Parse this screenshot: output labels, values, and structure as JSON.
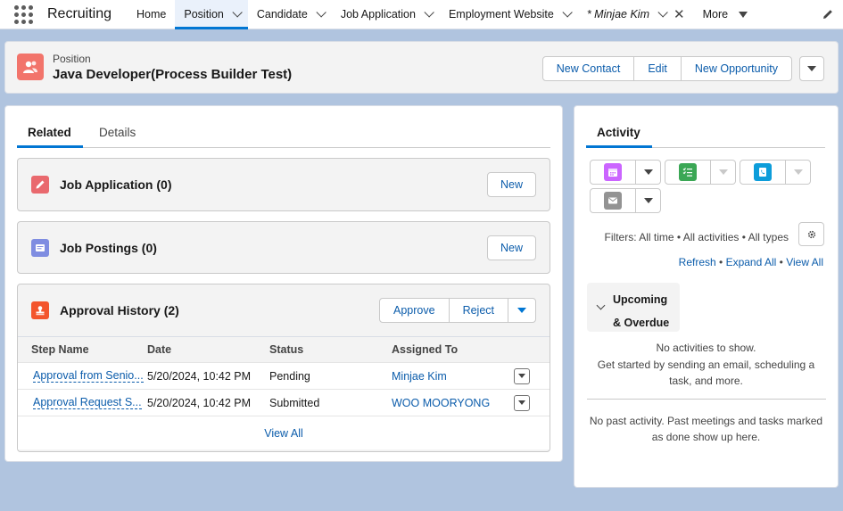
{
  "app": {
    "name": "Recruiting"
  },
  "nav": {
    "items": [
      {
        "label": "Home"
      },
      {
        "label": "Position"
      },
      {
        "label": "Candidate"
      },
      {
        "label": "Job Application"
      },
      {
        "label": "Employment Website"
      },
      {
        "label": "* Minjae Kim"
      },
      {
        "label": "More"
      }
    ]
  },
  "record": {
    "object_label": "Position",
    "title": "Java Developer(Process Builder Test)",
    "actions": {
      "new_contact": "New Contact",
      "edit": "Edit",
      "new_opportunity": "New Opportunity"
    }
  },
  "tabs": {
    "related": "Related",
    "details": "Details"
  },
  "related": {
    "job_application": {
      "title": "Job Application (0)",
      "new_label": "New"
    },
    "job_postings": {
      "title": "Job Postings (0)",
      "new_label": "New"
    },
    "approval_history": {
      "title": "Approval History (2)",
      "approve_label": "Approve",
      "reject_label": "Reject",
      "columns": [
        "Step Name",
        "Date",
        "Status",
        "Assigned To"
      ],
      "rows": [
        {
          "step": "Approval from Senio...",
          "date": "5/20/2024, 10:42 PM",
          "status": "Pending",
          "assigned": "Minjae Kim"
        },
        {
          "step": "Approval Request S...",
          "date": "5/20/2024, 10:42 PM",
          "status": "Submitted",
          "assigned": "WOO MOORYONG"
        }
      ],
      "view_all": "View All"
    }
  },
  "activity": {
    "tab": "Activity",
    "filters": "Filters: All time • All activities • All types",
    "links": {
      "refresh": "Refresh",
      "expand_all": "Expand All",
      "view_all": "View All"
    },
    "upcoming_label": "Upcoming & Overdue",
    "no_activities": "No activities to show.",
    "get_started": "Get started by sending an email, scheduling a task, and more.",
    "no_past": "No past activity. Past meetings and tasks marked as done show up here."
  },
  "colors": {
    "brand_blue": "#0176d3",
    "position_icon": "#f2746b",
    "background": "#b0c4df"
  }
}
